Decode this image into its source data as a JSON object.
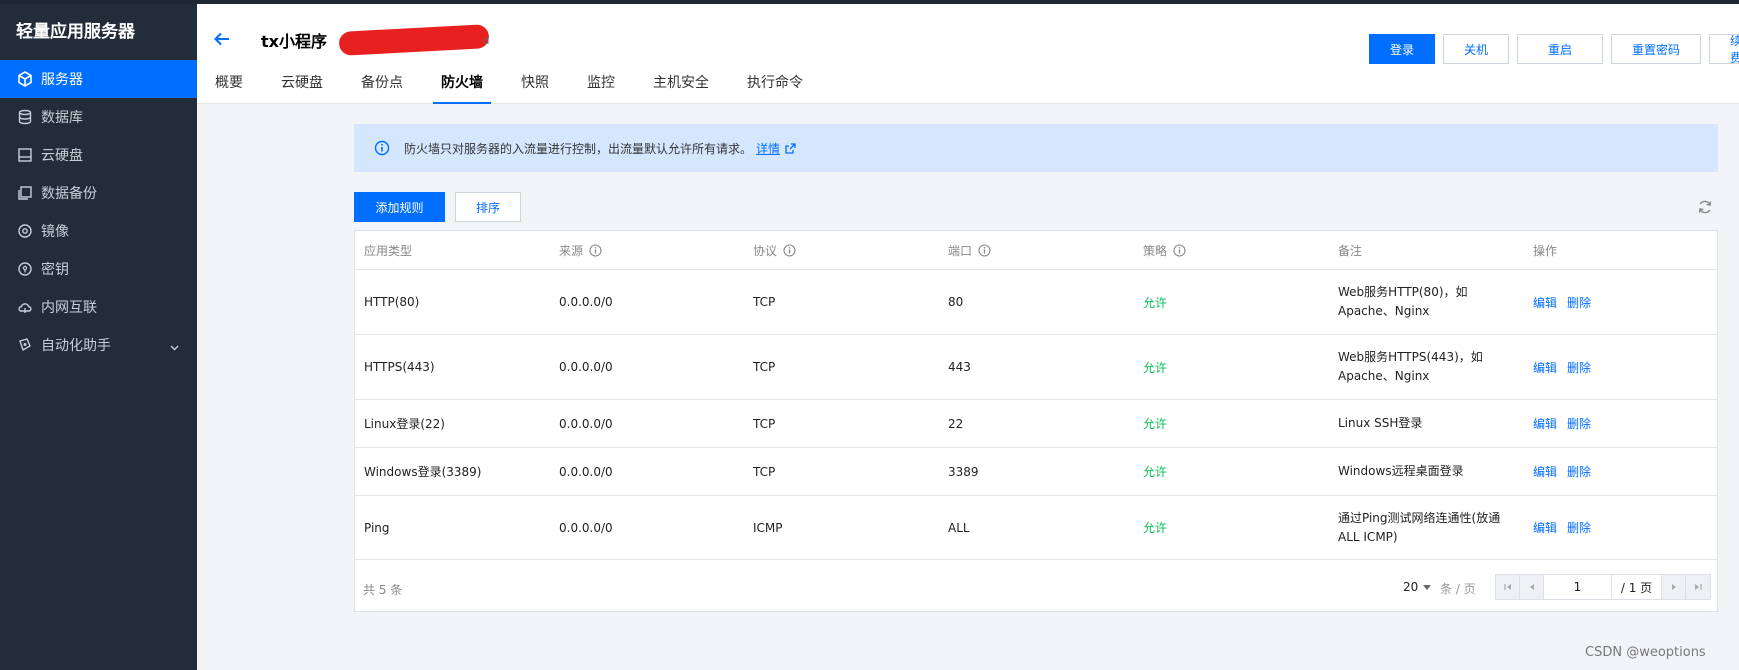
{
  "sidebar": {
    "brand": "轻量应用服务器",
    "items": [
      {
        "label": "服务器",
        "icon": "cube-icon"
      },
      {
        "label": "数据库",
        "icon": "database-icon"
      },
      {
        "label": "云硬盘",
        "icon": "disk-icon"
      },
      {
        "label": "数据备份",
        "icon": "backup-icon"
      },
      {
        "label": "镜像",
        "icon": "image-icon"
      },
      {
        "label": "密钥",
        "icon": "key-icon"
      },
      {
        "label": "内网互联",
        "icon": "network-icon"
      },
      {
        "label": "自动化助手",
        "icon": "automation-icon"
      }
    ]
  },
  "header": {
    "title": "tx小程序",
    "buttons": [
      "登录",
      "关机",
      "重启",
      "重置密码",
      "续费"
    ],
    "tabs": [
      "概要",
      "云硬盘",
      "备份点",
      "防火墙",
      "快照",
      "监控",
      "主机安全",
      "执行命令"
    ],
    "active_tab": "防火墙"
  },
  "notice": {
    "text": "防火墙只对服务器的入流量进行控制，出流量默认允许所有请求。",
    "link": "详情"
  },
  "toolbar": {
    "add": "添加规则",
    "sort": "排序"
  },
  "table": {
    "headers": [
      "应用类型",
      "来源",
      "协议",
      "端口",
      "策略",
      "备注",
      "操作"
    ],
    "rows": [
      {
        "type": "HTTP(80)",
        "source": "0.0.0.0/0",
        "protocol": "TCP",
        "port": "80",
        "policy": "允许",
        "remark1": "Web服务HTTP(80)，如",
        "remark2": "Apache、Nginx",
        "edit": "编辑",
        "delete": "删除"
      },
      {
        "type": "HTTPS(443)",
        "source": "0.0.0.0/0",
        "protocol": "TCP",
        "port": "443",
        "policy": "允许",
        "remark1": "Web服务HTTPS(443)，如",
        "remark2": "Apache、Nginx",
        "edit": "编辑",
        "delete": "删除"
      },
      {
        "type": "Linux登录(22)",
        "source": "0.0.0.0/0",
        "protocol": "TCP",
        "port": "22",
        "policy": "允许",
        "remark1": "Linux SSH登录",
        "remark2": "",
        "edit": "编辑",
        "delete": "删除"
      },
      {
        "type": "Windows登录(3389)",
        "source": "0.0.0.0/0",
        "protocol": "TCP",
        "port": "3389",
        "policy": "允许",
        "remark1": "Windows远程桌面登录",
        "remark2": "",
        "edit": "编辑",
        "delete": "删除"
      },
      {
        "type": "Ping",
        "source": "0.0.0.0/0",
        "protocol": "ICMP",
        "port": "ALL",
        "policy": "允许",
        "remark1": "通过Ping测试网络连通性(放通",
        "remark2": "ALL ICMP)",
        "edit": "编辑",
        "delete": "删除"
      }
    ]
  },
  "footer": {
    "total": "共 5 条",
    "page_size": "20",
    "page_unit": "条 / 页",
    "page": "1",
    "pages": "/ 1 页"
  },
  "watermark": "CSDN @weoptions",
  "colors": {
    "accent": "#006eff",
    "sidebar": "#232d3a",
    "allow": "#0abf5b",
    "notice_bg": "#d5e7ff"
  }
}
